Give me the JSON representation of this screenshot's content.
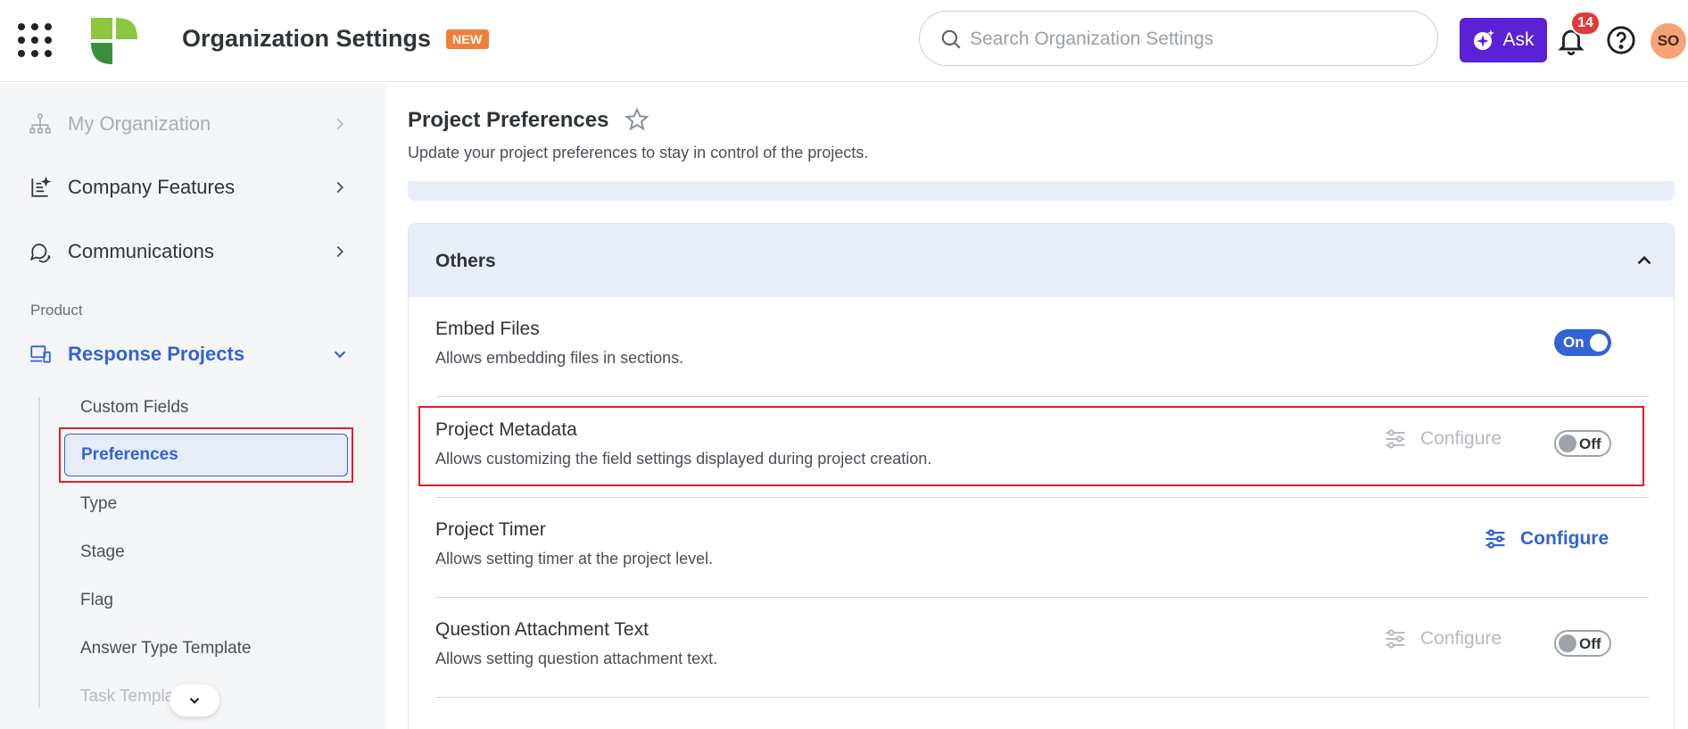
{
  "header": {
    "title": "Organization Settings",
    "badge": "NEW",
    "search_placeholder": "Search Organization Settings",
    "ask_label": "Ask",
    "notification_count": "14",
    "avatar_initials": "SO"
  },
  "sidebar": {
    "items": [
      {
        "label": "My Organization"
      },
      {
        "label": "Company Features"
      },
      {
        "label": "Communications"
      }
    ],
    "section_label": "Product",
    "product": {
      "label": "Response Projects"
    },
    "subitems": [
      {
        "label": "Custom Fields"
      },
      {
        "label": "Preferences"
      },
      {
        "label": "Type"
      },
      {
        "label": "Stage"
      },
      {
        "label": "Flag"
      },
      {
        "label": "Answer Type Template"
      },
      {
        "label": "Task Templa"
      }
    ]
  },
  "main": {
    "title": "Project Preferences",
    "subtitle": "Update your project preferences to stay in control of the projects.",
    "section_title": "Others",
    "rows": [
      {
        "title": "Embed Files",
        "description": "Allows embedding files in sections.",
        "toggle": "On"
      },
      {
        "title": "Project Metadata",
        "description": "Allows customizing the field settings displayed during project creation.",
        "configure": "Configure",
        "toggle": "Off"
      },
      {
        "title": "Project Timer",
        "description": "Allows setting timer at the project level.",
        "configure": "Configure"
      },
      {
        "title": "Question Attachment Text",
        "description": "Allows setting question attachment text.",
        "configure": "Configure",
        "toggle": "Off"
      }
    ]
  },
  "colors": {
    "accent": "#3463d6",
    "ask_button": "#5b21d6",
    "highlight_border": "#e01f26",
    "badge_new": "#f07f3c",
    "notification": "#e03a3a"
  },
  "icons": [
    "apps-grid-icon",
    "logo",
    "search-icon",
    "ai-spark-icon",
    "bell-icon",
    "help-icon",
    "org-tree-icon",
    "features-icon",
    "chat-icon",
    "product-icon",
    "chevron-right-icon",
    "chevron-down-icon",
    "chevron-up-icon",
    "star-icon",
    "sliders-icon"
  ]
}
